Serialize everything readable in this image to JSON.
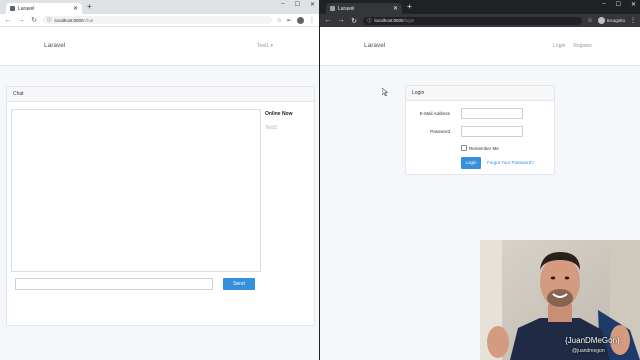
{
  "left_window": {
    "tab_title": "Laravel",
    "url_host": "localhost:8000",
    "url_path": "/chat",
    "brand": "Laravel",
    "user_menu": "Test1",
    "chat": {
      "header": "Chat",
      "online_title": "Online Now",
      "online_users": [
        "Test3"
      ],
      "send_label": "Send"
    }
  },
  "right_window": {
    "tab_title": "Laravel",
    "url_host": "localhost:8000",
    "url_path": "/login",
    "incognito_label": "Incognito",
    "brand": "Laravel",
    "nav_login": "Login",
    "nav_register": "Register",
    "login_form": {
      "header": "Login",
      "email_label": "E-Mail Address",
      "password_label": "Password",
      "remember_label": "Remember Me",
      "login_button": "Login",
      "forgot_link": "Forgot Your Password?"
    }
  },
  "webcam": {
    "handle": "{JuanDMeGon}",
    "sub": "@juandmegon"
  },
  "colors": {
    "primary": "#3490dc",
    "dark_chrome": "#202124",
    "light_chrome": "#dee1e6"
  },
  "icons": [
    "back-icon",
    "forward-icon",
    "reload-icon",
    "info-icon",
    "star-icon",
    "account-icon",
    "menu-icon",
    "close-icon",
    "plus-icon",
    "minimize-icon",
    "maximize-icon",
    "incognito-icon"
  ]
}
